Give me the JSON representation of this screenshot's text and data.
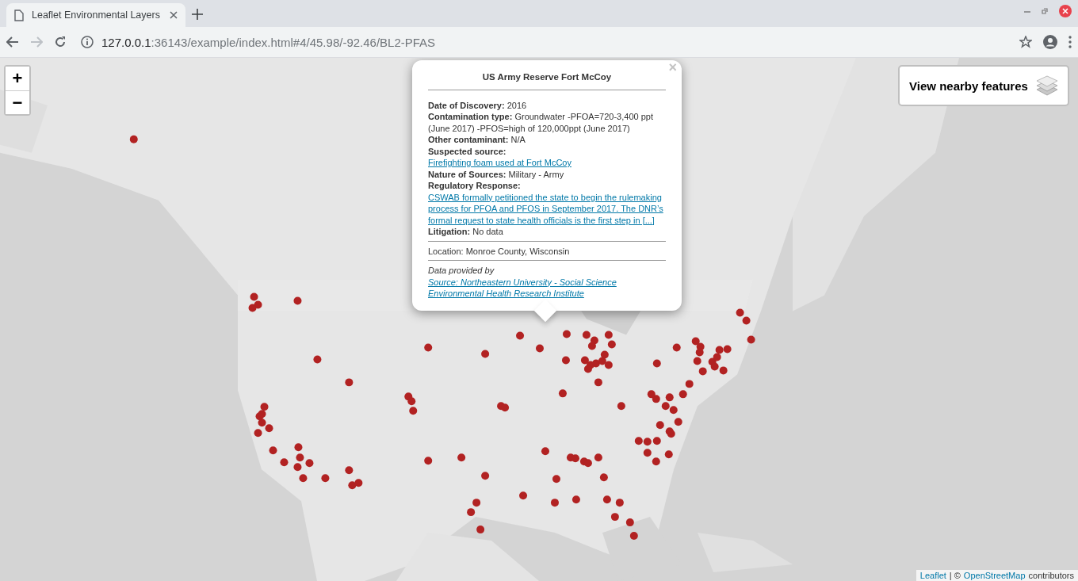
{
  "tab": {
    "title": "Leaflet Environmental Layers",
    "selected": true
  },
  "address_bar": {
    "host": "127.0.0.1",
    "path": ":36143/example/index.html#4/45.98/-92.46/BL2-PFAS"
  },
  "zoom_controls": [
    "+",
    "−"
  ],
  "popup": {
    "title": "US Army Reserve Fort McCoy",
    "close": "×",
    "fields": [
      {
        "label": "Date of Discovery:",
        "value": "2016",
        "kind": "text"
      },
      {
        "label": "Contamination type:",
        "value": "Groundwater -PFOA=720-3,400 ppt (June 2017) -PFOS=high of 120,000ppt (June 2017)",
        "kind": "text"
      },
      {
        "label": "Other contaminant:",
        "value": "N/A",
        "kind": "text"
      },
      {
        "label": "Suspected source:",
        "value": "Firefighting foam used at Fort McCoy",
        "kind": "link"
      },
      {
        "label": "Nature of Sources:",
        "value": "Military - Army",
        "kind": "text"
      },
      {
        "label": "Regulatory Response:",
        "value": "CSWAB formally petitioned the state to begin the rulemaking process for PFOA and PFOS in September 2017. The DNR’s formal request to state health officials is the first step in [...]",
        "kind": "link"
      },
      {
        "label": "Litigation:",
        "value": "No data",
        "kind": "text"
      }
    ],
    "location": "Location: Monroe County, Wisconsin",
    "credit_prefix": "Data provided by",
    "credit_link": "Source: Northeastern University - Social Science Environmental Health Research Institute"
  },
  "layers_button": {
    "label": "View nearby features"
  },
  "attribution": {
    "leaflet": "Leaflet",
    "separator": "| ©",
    "osm": "OpenStreetMap",
    "suffix": "contributors"
  }
}
